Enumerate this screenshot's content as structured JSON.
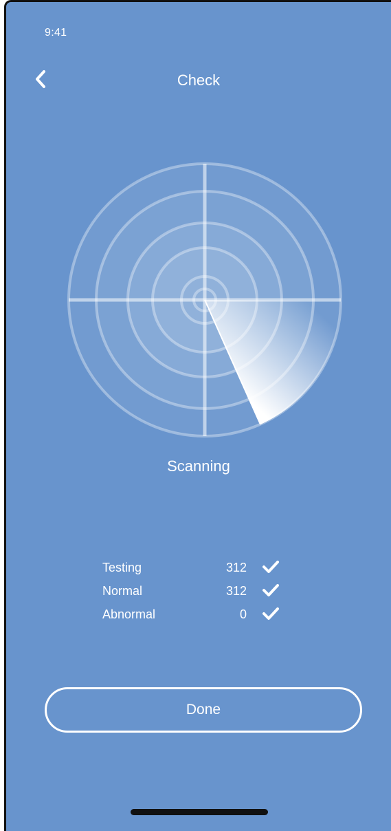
{
  "status_bar": {
    "time": "9:41"
  },
  "header": {
    "title": "Check",
    "back_icon": "chevron-left-icon"
  },
  "scanner": {
    "status": "Scanning"
  },
  "stats": [
    {
      "label": "Testing",
      "value": "312",
      "icon": "checkmark-icon"
    },
    {
      "label": "Normal",
      "value": "312",
      "icon": "checkmark-icon"
    },
    {
      "label": "Abnormal",
      "value": "0",
      "icon": "checkmark-icon"
    }
  ],
  "actions": {
    "done_label": "Done"
  },
  "colors": {
    "background": "#6894cd",
    "foreground": "#ffffff"
  }
}
